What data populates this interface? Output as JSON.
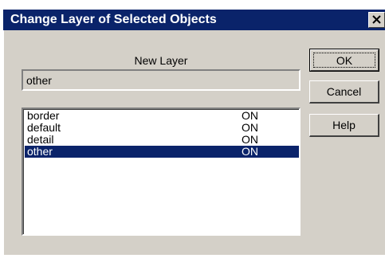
{
  "dialog": {
    "title": "Change Layer of Selected Objects",
    "close_icon": "close-icon"
  },
  "new_layer": {
    "label": "New Layer",
    "value": "other"
  },
  "layers": [
    {
      "name": "border",
      "state": "ON",
      "selected": false
    },
    {
      "name": "default",
      "state": "ON",
      "selected": false
    },
    {
      "name": "detail",
      "state": "ON",
      "selected": false
    },
    {
      "name": "other",
      "state": "ON",
      "selected": true
    }
  ],
  "buttons": {
    "ok": "OK",
    "cancel": "Cancel",
    "help": "Help"
  },
  "colors": {
    "titlebar": "#0a236a",
    "selection": "#0a236a",
    "face": "#d4d0c8"
  }
}
